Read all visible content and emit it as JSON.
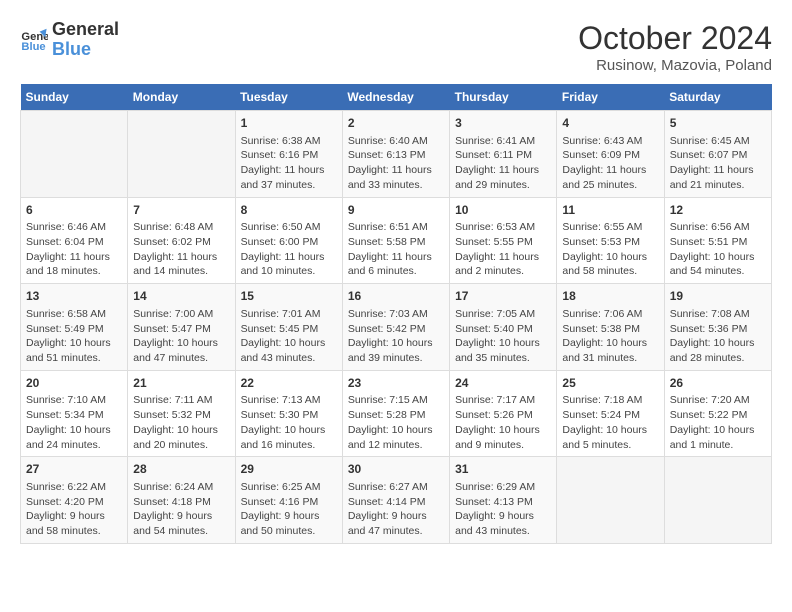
{
  "logo": {
    "line1": "General",
    "line2": "Blue"
  },
  "title": "October 2024",
  "subtitle": "Rusinow, Mazovia, Poland",
  "days_header": [
    "Sunday",
    "Monday",
    "Tuesday",
    "Wednesday",
    "Thursday",
    "Friday",
    "Saturday"
  ],
  "weeks": [
    [
      {
        "day": "",
        "info": ""
      },
      {
        "day": "",
        "info": ""
      },
      {
        "day": "1",
        "info": "Sunrise: 6:38 AM\nSunset: 6:16 PM\nDaylight: 11 hours and 37 minutes."
      },
      {
        "day": "2",
        "info": "Sunrise: 6:40 AM\nSunset: 6:13 PM\nDaylight: 11 hours and 33 minutes."
      },
      {
        "day": "3",
        "info": "Sunrise: 6:41 AM\nSunset: 6:11 PM\nDaylight: 11 hours and 29 minutes."
      },
      {
        "day": "4",
        "info": "Sunrise: 6:43 AM\nSunset: 6:09 PM\nDaylight: 11 hours and 25 minutes."
      },
      {
        "day": "5",
        "info": "Sunrise: 6:45 AM\nSunset: 6:07 PM\nDaylight: 11 hours and 21 minutes."
      }
    ],
    [
      {
        "day": "6",
        "info": "Sunrise: 6:46 AM\nSunset: 6:04 PM\nDaylight: 11 hours and 18 minutes."
      },
      {
        "day": "7",
        "info": "Sunrise: 6:48 AM\nSunset: 6:02 PM\nDaylight: 11 hours and 14 minutes."
      },
      {
        "day": "8",
        "info": "Sunrise: 6:50 AM\nSunset: 6:00 PM\nDaylight: 11 hours and 10 minutes."
      },
      {
        "day": "9",
        "info": "Sunrise: 6:51 AM\nSunset: 5:58 PM\nDaylight: 11 hours and 6 minutes."
      },
      {
        "day": "10",
        "info": "Sunrise: 6:53 AM\nSunset: 5:55 PM\nDaylight: 11 hours and 2 minutes."
      },
      {
        "day": "11",
        "info": "Sunrise: 6:55 AM\nSunset: 5:53 PM\nDaylight: 10 hours and 58 minutes."
      },
      {
        "day": "12",
        "info": "Sunrise: 6:56 AM\nSunset: 5:51 PM\nDaylight: 10 hours and 54 minutes."
      }
    ],
    [
      {
        "day": "13",
        "info": "Sunrise: 6:58 AM\nSunset: 5:49 PM\nDaylight: 10 hours and 51 minutes."
      },
      {
        "day": "14",
        "info": "Sunrise: 7:00 AM\nSunset: 5:47 PM\nDaylight: 10 hours and 47 minutes."
      },
      {
        "day": "15",
        "info": "Sunrise: 7:01 AM\nSunset: 5:45 PM\nDaylight: 10 hours and 43 minutes."
      },
      {
        "day": "16",
        "info": "Sunrise: 7:03 AM\nSunset: 5:42 PM\nDaylight: 10 hours and 39 minutes."
      },
      {
        "day": "17",
        "info": "Sunrise: 7:05 AM\nSunset: 5:40 PM\nDaylight: 10 hours and 35 minutes."
      },
      {
        "day": "18",
        "info": "Sunrise: 7:06 AM\nSunset: 5:38 PM\nDaylight: 10 hours and 31 minutes."
      },
      {
        "day": "19",
        "info": "Sunrise: 7:08 AM\nSunset: 5:36 PM\nDaylight: 10 hours and 28 minutes."
      }
    ],
    [
      {
        "day": "20",
        "info": "Sunrise: 7:10 AM\nSunset: 5:34 PM\nDaylight: 10 hours and 24 minutes."
      },
      {
        "day": "21",
        "info": "Sunrise: 7:11 AM\nSunset: 5:32 PM\nDaylight: 10 hours and 20 minutes."
      },
      {
        "day": "22",
        "info": "Sunrise: 7:13 AM\nSunset: 5:30 PM\nDaylight: 10 hours and 16 minutes."
      },
      {
        "day": "23",
        "info": "Sunrise: 7:15 AM\nSunset: 5:28 PM\nDaylight: 10 hours and 12 minutes."
      },
      {
        "day": "24",
        "info": "Sunrise: 7:17 AM\nSunset: 5:26 PM\nDaylight: 10 hours and 9 minutes."
      },
      {
        "day": "25",
        "info": "Sunrise: 7:18 AM\nSunset: 5:24 PM\nDaylight: 10 hours and 5 minutes."
      },
      {
        "day": "26",
        "info": "Sunrise: 7:20 AM\nSunset: 5:22 PM\nDaylight: 10 hours and 1 minute."
      }
    ],
    [
      {
        "day": "27",
        "info": "Sunrise: 6:22 AM\nSunset: 4:20 PM\nDaylight: 9 hours and 58 minutes."
      },
      {
        "day": "28",
        "info": "Sunrise: 6:24 AM\nSunset: 4:18 PM\nDaylight: 9 hours and 54 minutes."
      },
      {
        "day": "29",
        "info": "Sunrise: 6:25 AM\nSunset: 4:16 PM\nDaylight: 9 hours and 50 minutes."
      },
      {
        "day": "30",
        "info": "Sunrise: 6:27 AM\nSunset: 4:14 PM\nDaylight: 9 hours and 47 minutes."
      },
      {
        "day": "31",
        "info": "Sunrise: 6:29 AM\nSunset: 4:13 PM\nDaylight: 9 hours and 43 minutes."
      },
      {
        "day": "",
        "info": ""
      },
      {
        "day": "",
        "info": ""
      }
    ]
  ]
}
